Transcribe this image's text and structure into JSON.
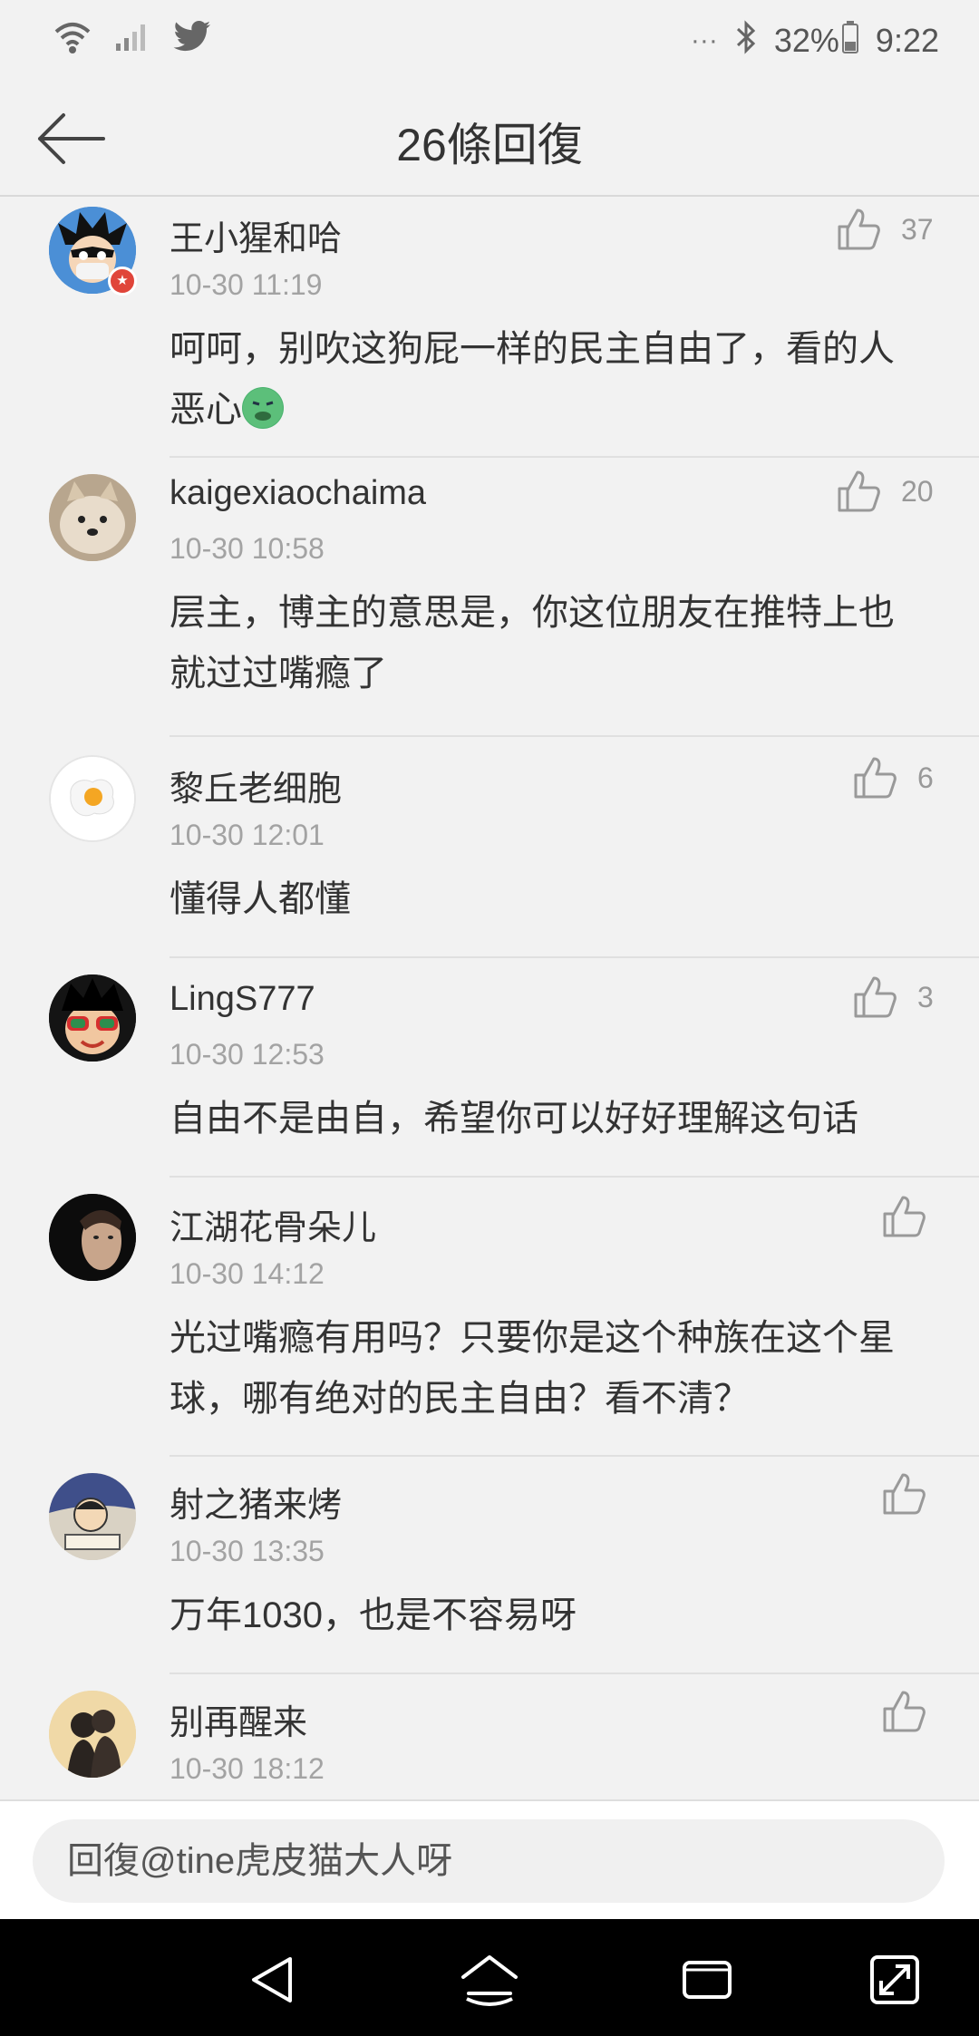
{
  "status_bar": {
    "battery": "32%",
    "time": "9:22",
    "dots": "···"
  },
  "header": {
    "title": "26條回復"
  },
  "comments": [
    {
      "name": "王小猩和哈",
      "time": "10-30 11:19",
      "likes": "37",
      "text_line1": "呵呵，别吹这狗屁一样的民主自由了，看的人",
      "text_line2": "恶心",
      "avatar": "anime-boy-mask-avatar",
      "badge_icon": "star-badge-icon"
    },
    {
      "name": "kaigexiaochaima",
      "time": "10-30 10:58",
      "likes": "20",
      "text_line1": "层主，博主的意思是，你这位朋友在推特上也",
      "text_line2": "就过过嘴瘾了",
      "avatar": "shiba-puppy-avatar"
    },
    {
      "name": "黎丘老细胞",
      "time": "10-30 12:01",
      "likes": "6",
      "text": "懂得人都懂",
      "avatar": "fried-egg-avatar"
    },
    {
      "name": "LingS777",
      "time": "10-30 12:53",
      "likes": "3",
      "text": "自由不是由自，希望你可以好好理解这句话",
      "avatar": "anime-sunglasses-avatar"
    },
    {
      "name": "江湖花骨朵儿",
      "time": "10-30 14:12",
      "likes": "",
      "text_line1": "光过嘴瘾有用吗？只要你是这个种族在这个星",
      "text_line2": "球，哪有绝对的民主自由？看不清？",
      "avatar": "portrait-man-avatar"
    },
    {
      "name": "射之猪来烤",
      "time": "10-30 13:35",
      "likes": "",
      "text": "万年1030，也是不容易呀",
      "avatar": "cartoon-reading-avatar"
    },
    {
      "name": "别再醒来",
      "time": "10-30 18:12",
      "likes": "",
      "avatar": "couple-silhouette-avatar"
    }
  ],
  "reply": {
    "placeholder": "回復@tine虎皮猫大人呀"
  },
  "colors": {
    "background": "#f2f2f2",
    "text": "#333333",
    "muted": "#a3a3a3",
    "divider": "#e0e0e0",
    "nav": "#000000"
  }
}
